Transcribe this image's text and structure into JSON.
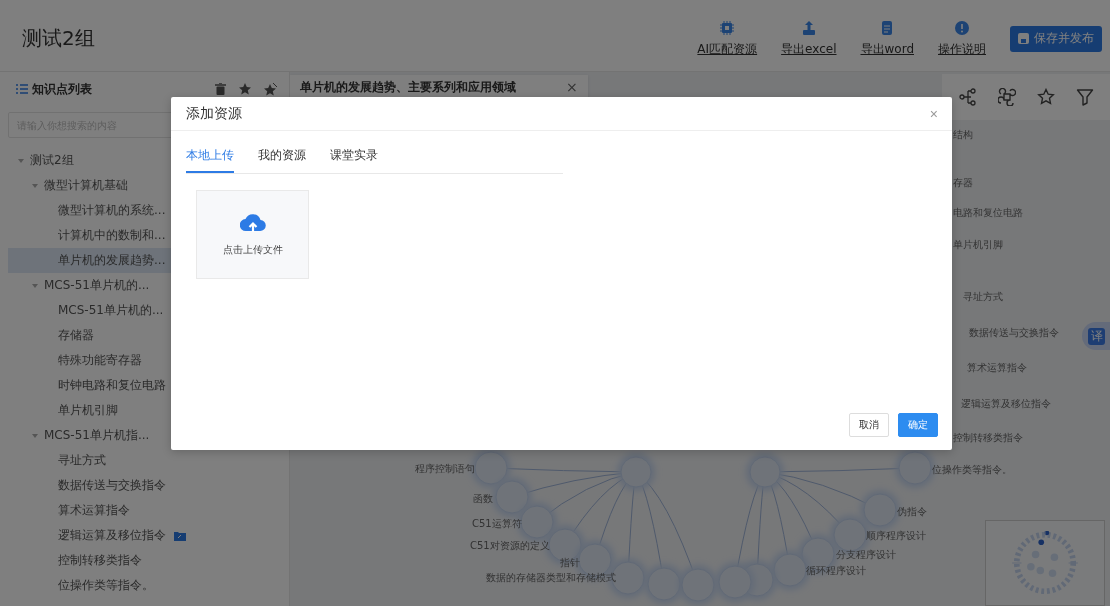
{
  "header": {
    "title": "测试2组",
    "actions": [
      {
        "label": "AI匹配资源",
        "kind": "chip"
      },
      {
        "label": "导出excel",
        "kind": "export"
      },
      {
        "label": "导出word",
        "kind": "document"
      },
      {
        "label": "操作说明",
        "kind": "info"
      }
    ],
    "save_button": "保存并发布"
  },
  "sidebar": {
    "title": "知识点列表",
    "search": {
      "placeholder": "请输入你想搜索的内容"
    },
    "tree": [
      {
        "label": "测试2组",
        "expanded": true,
        "selected": false,
        "children": [
          {
            "label": "微型计算机基础",
            "expanded": true,
            "selected": false,
            "children": [
              {
                "label": "微型计算机的系统...",
                "selected": false,
                "attached": false
              },
              {
                "label": "计算机中的数制和...",
                "selected": false,
                "attached": false
              },
              {
                "label": "单片机的发展趋势...",
                "selected": true,
                "attached": false
              }
            ]
          },
          {
            "label": "MCS-51单片机的...",
            "expanded": true,
            "selected": false,
            "children": [
              {
                "label": "MCS-51单片机的...",
                "selected": false,
                "attached": false
              },
              {
                "label": "存储器",
                "selected": false,
                "attached": false
              },
              {
                "label": "特殊功能寄存器",
                "selected": false,
                "attached": false
              },
              {
                "label": "时钟电路和复位电路",
                "selected": false,
                "attached": false
              },
              {
                "label": "单片机引脚",
                "selected": false,
                "attached": false
              }
            ]
          },
          {
            "label": "MCS-51单片机指...",
            "expanded": true,
            "selected": false,
            "children": [
              {
                "label": "寻址方式",
                "selected": false,
                "attached": false
              },
              {
                "label": "数据传送与交换指令",
                "selected": false,
                "attached": false
              },
              {
                "label": "算术运算指令",
                "selected": false,
                "attached": false
              },
              {
                "label": "逻辑运算及移位指令",
                "selected": false,
                "attached": true
              },
              {
                "label": "控制转移类指令",
                "selected": false,
                "attached": false
              },
              {
                "label": "位操作类等指令。",
                "selected": false,
                "attached": false
              }
            ]
          }
        ]
      }
    ]
  },
  "tabs": [
    {
      "label": "单片机的发展趋势、主要系列和应用领域",
      "selected": true,
      "close": "×"
    }
  ],
  "graph": {
    "labels": [
      "结构",
      "存器",
      "电路和复位电路",
      "单片机引脚",
      "寻址方式",
      "数据传送与交换指令",
      "算术运算指令",
      "逻辑运算及移位指令",
      "控制转移类指令",
      "程序控制语句",
      "位操作类等指令。",
      "函数",
      "伪指令",
      "C51运算符",
      "顺序程序设计",
      "C51对资源的定义",
      "分支程序设计",
      "指针",
      "循环程序设计",
      "数据的存储器类型和存储模式"
    ]
  },
  "translate_button": "译",
  "dialog": {
    "title": "添加资源",
    "close": "×",
    "tabs": [
      {
        "label": "本地上传",
        "selected": true
      },
      {
        "label": "我的资源",
        "selected": false
      },
      {
        "label": "课堂实录",
        "selected": false
      }
    ],
    "upload": {
      "label": "点击上传文件"
    },
    "buttons": [
      {
        "label": "取消",
        "kind": "secondary"
      },
      {
        "label": "确定",
        "kind": "primary"
      }
    ]
  }
}
